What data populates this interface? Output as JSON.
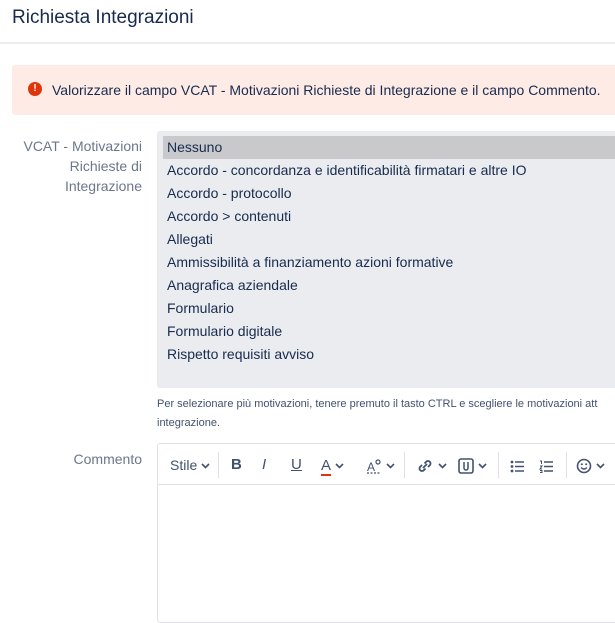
{
  "header": {
    "title": "Richiesta Integrazioni"
  },
  "error": {
    "message": "Valorizzare il campo VCAT - Motivazioni Richieste di Integrazione e il campo Commento."
  },
  "vcat_field": {
    "label_line1": "VCAT - Motivazioni",
    "label_line2": "Richieste di",
    "label_line3": "Integrazione",
    "options": [
      "Nessuno",
      "Accordo - concordanza e identificabilità firmatari e altre IO",
      "Accordo - protocollo",
      "Accordo > contenuti",
      "Allegati",
      "Ammissibilità a finanziamento azioni formative",
      "Anagrafica aziendale",
      "Formulario",
      "Formulario digitale",
      "Rispetto requisiti avviso"
    ],
    "selected": "Nessuno",
    "hint_line1": "Per selezionare più motivazioni, tenere premuto il tasto CTRL e scegliere le motivazioni att",
    "hint_line2": "integrazione."
  },
  "comment_field": {
    "label": "Commento",
    "toolbar": {
      "style_label": "Stile",
      "items": [
        "style-dropdown",
        "bold",
        "italic",
        "underline",
        "text-color",
        "more-formatting",
        "link",
        "attachment",
        "bullet-list",
        "numbered-list",
        "emoji"
      ]
    }
  },
  "colors": {
    "error_bg": "#ffebe6",
    "error_icon": "#de350b",
    "text_color_underline": "#de350b"
  }
}
